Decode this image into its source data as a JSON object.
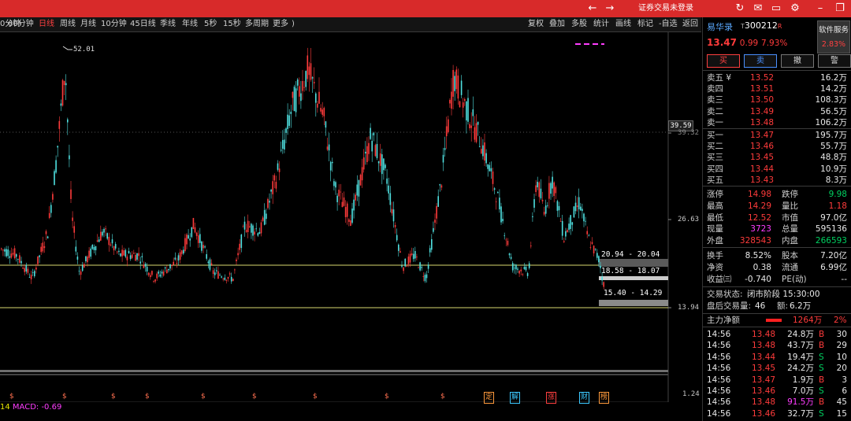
{
  "titlebar": {
    "login_status": "证券交易未登录",
    "icons": [
      "back-arrow-icon",
      "refresh-icon",
      "mail-icon",
      "display-icon",
      "gear-icon",
      "minimize-icon",
      "restore-icon"
    ]
  },
  "toolbar": {
    "periods": [
      "60分钟",
      "日线",
      "周线",
      "月线",
      "10分钟",
      "45日线",
      "季线",
      "年线",
      "5秒",
      "15秒",
      "多周期",
      "更多"
    ],
    "first_partial": "0分钟",
    "active_period": "日线",
    "tools": [
      "复权",
      "叠加",
      "多股",
      "统计",
      "画线",
      "标记",
      "-自选",
      "返回"
    ],
    "more_arrow": ")"
  },
  "chart": {
    "high_label": "52.01",
    "price_axis": [
      "39.32",
      "26.63",
      "13.94",
      "1.24"
    ],
    "current_price_box": "39.59",
    "zones": [
      {
        "label": "20.94 - 20.04"
      },
      {
        "label": "18.58 - 18.07"
      },
      {
        "label": "15.40 - 14.29"
      }
    ],
    "markers": [
      "$",
      "$",
      "$",
      "$",
      "$",
      "$",
      "$",
      "$",
      "$"
    ],
    "events": [
      {
        "text": "定",
        "color": "#ff9a3c"
      },
      {
        "text": "解",
        "color": "#3cc8ff"
      },
      {
        "text": "涨",
        "color": "#ff4040"
      },
      {
        "text": "财",
        "color": "#3cc8ff"
      },
      {
        "text": "榜",
        "color": "#ff9a3c"
      }
    ],
    "macd_prefix": "14",
    "macd_label": "MACD: -0.69"
  },
  "chart_data": {
    "type": "candlestick",
    "y_axis_ticks": [
      39.32,
      26.63,
      13.94,
      1.24
    ],
    "highest": 52.01,
    "current_price_marker": 39.59,
    "horizontal_lines": [
      20.94,
      14.29
    ],
    "zones": [
      [
        20.04,
        20.94
      ],
      [
        18.07,
        18.58
      ],
      [
        14.29,
        15.4
      ]
    ],
    "macd": -0.69
  },
  "quote": {
    "name": "易华录",
    "code": "300212",
    "code_prefix": "T",
    "code_suffix": "R",
    "price": "13.47",
    "change": "0.99",
    "change_pct": "7.93%",
    "soft_service_label": "软件服务",
    "soft_service_pct": "2.83%",
    "buttons": [
      "买",
      "卖",
      "撤",
      "警"
    ],
    "asks": [
      {
        "label": "卖五 ¥",
        "price": "13.52",
        "vol": "16.2万"
      },
      {
        "label": "卖四",
        "price": "13.51",
        "vol": "14.2万"
      },
      {
        "label": "卖三",
        "price": "13.50",
        "vol": "108.3万"
      },
      {
        "label": "卖二",
        "price": "13.49",
        "vol": "56.5万"
      },
      {
        "label": "卖一",
        "price": "13.48",
        "vol": "106.2万"
      }
    ],
    "bids": [
      {
        "label": "买一",
        "price": "13.47",
        "vol": "195.7万"
      },
      {
        "label": "买二",
        "price": "13.46",
        "vol": "55.7万"
      },
      {
        "label": "买三",
        "price": "13.45",
        "vol": "48.8万"
      },
      {
        "label": "买四",
        "price": "13.44",
        "vol": "10.9万"
      },
      {
        "label": "买五",
        "price": "13.43",
        "vol": "8.3万"
      }
    ],
    "stats": [
      [
        {
          "l": "涨停",
          "v": "14.98",
          "c": "red"
        },
        {
          "l": "跌停",
          "v": "9.98",
          "c": "green"
        }
      ],
      [
        {
          "l": "最高",
          "v": "14.29",
          "c": "red"
        },
        {
          "l": "量比",
          "v": "1.18",
          "c": "red"
        }
      ],
      [
        {
          "l": "最低",
          "v": "12.52",
          "c": "red"
        },
        {
          "l": "市值",
          "v": "97.0亿",
          "c": "white"
        }
      ],
      [
        {
          "l": "现量",
          "v": "3723",
          "c": "magenta"
        },
        {
          "l": "总量",
          "v": "595136",
          "c": "white"
        }
      ],
      [
        {
          "l": "外盘",
          "v": "328543",
          "c": "red"
        },
        {
          "l": "内盘",
          "v": "266593",
          "c": "green"
        }
      ]
    ],
    "stats2": [
      [
        {
          "l": "换手",
          "v": "8.52%",
          "c": "white"
        },
        {
          "l": "股本",
          "v": "7.20亿",
          "c": "white"
        }
      ],
      [
        {
          "l": "净资",
          "v": "0.38",
          "c": "white"
        },
        {
          "l": "流通",
          "v": "6.99亿",
          "c": "white"
        }
      ],
      [
        {
          "l": "收益㈢",
          "v": "-0.740",
          "c": "white"
        },
        {
          "l": "PE(动)",
          "v": "--",
          "c": "white"
        }
      ]
    ],
    "trade_status_label": "交易状态:",
    "trade_status_value": "闭市阶段 15:30:00",
    "after_hours_label": "盘后交易量:",
    "after_hours_vol": "46",
    "after_hours_amt_label": "额:",
    "after_hours_amt": "6.2万",
    "main_net_label": "主力净额",
    "main_net_value": "1264万",
    "main_net_pct": "2%",
    "ticks": [
      {
        "t": "14:56",
        "p": "13.48",
        "v": "24.8万",
        "bs": "B",
        "n": "30",
        "vc": "white"
      },
      {
        "t": "14:56",
        "p": "13.48",
        "v": "43.7万",
        "bs": "B",
        "n": "29",
        "vc": "white"
      },
      {
        "t": "14:56",
        "p": "13.44",
        "v": "19.4万",
        "bs": "S",
        "n": "10",
        "vc": "white"
      },
      {
        "t": "14:56",
        "p": "13.45",
        "v": "24.2万",
        "bs": "S",
        "n": "20",
        "vc": "white"
      },
      {
        "t": "14:56",
        "p": "13.47",
        "v": "1.9万",
        "bs": "B",
        "n": "3",
        "vc": "white"
      },
      {
        "t": "14:56",
        "p": "13.46",
        "v": "7.0万",
        "bs": "S",
        "n": "6",
        "vc": "white"
      },
      {
        "t": "14:56",
        "p": "13.48",
        "v": "91.5万",
        "bs": "B",
        "n": "45",
        "vc": "magenta"
      },
      {
        "t": "14:56",
        "p": "13.46",
        "v": "32.7万",
        "bs": "S",
        "n": "15",
        "vc": "white"
      }
    ]
  }
}
